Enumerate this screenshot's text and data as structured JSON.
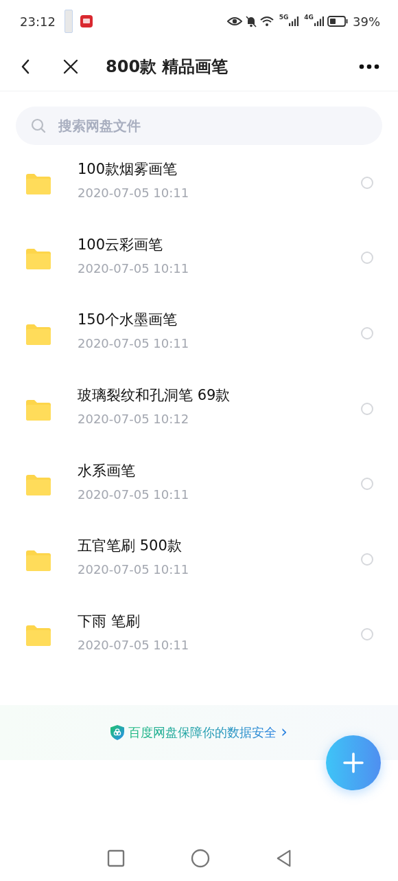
{
  "status_bar": {
    "time": "23:12",
    "network_1": "5G",
    "network_2": "4G",
    "battery": "39%"
  },
  "header": {
    "title": "800款 精品画笔"
  },
  "search": {
    "placeholder": "搜索网盘文件"
  },
  "files": [
    {
      "name": "100款烟雾画笔",
      "date": "2020-07-05  10:11",
      "selected": false
    },
    {
      "name": "100云彩画笔",
      "date": "2020-07-05  10:11",
      "selected": false
    },
    {
      "name": "150个水墨画笔",
      "date": "2020-07-05  10:11",
      "selected": false
    },
    {
      "name": "玻璃裂纹和孔洞笔 69款",
      "date": "2020-07-05  10:12",
      "selected": false
    },
    {
      "name": "水系画笔",
      "date": "2020-07-05  10:11",
      "selected": false
    },
    {
      "name": "五官笔刷 500款",
      "date": "2020-07-05  10:11",
      "selected": false
    },
    {
      "name": "下雨 笔刷",
      "date": "2020-07-05  10:11",
      "selected": false
    }
  ],
  "security_banner": {
    "text": "百度网盘保障你的数据安全",
    "arrow": "›"
  }
}
